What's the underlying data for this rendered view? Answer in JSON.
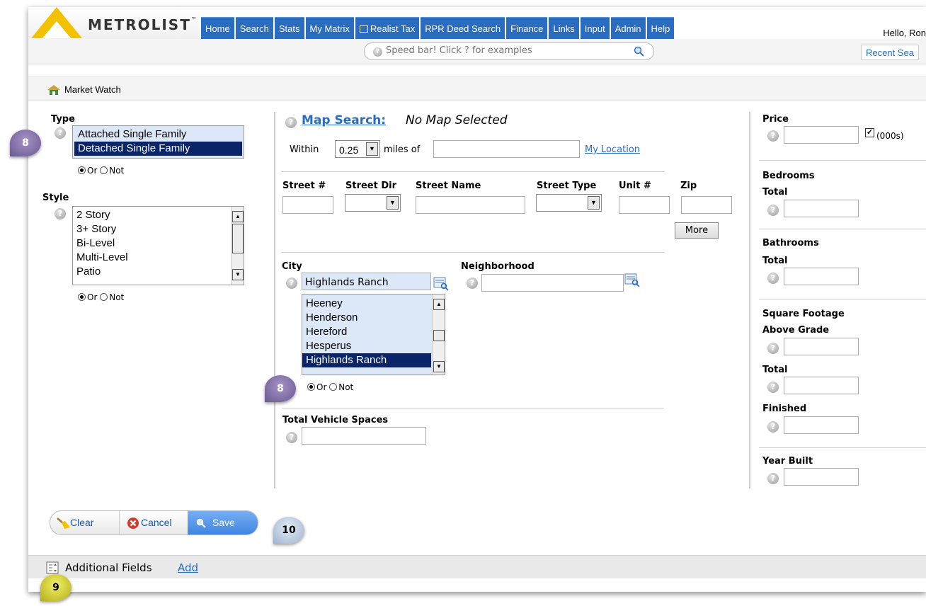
{
  "logo": {
    "text": "METROLIST",
    "tm": "™"
  },
  "nav": [
    "Home",
    "Search",
    "Stats",
    "My Matrix",
    "Realist Tax",
    "RPR Deed Search",
    "Finance",
    "Links",
    "Input",
    "Admin",
    "Help"
  ],
  "greeting": "Hello, Ron",
  "speedbar": {
    "placeholder": "Speed bar! Click ? for examples"
  },
  "recent": "Recent Sea",
  "page_title": "Market Watch",
  "type": {
    "label": "Type",
    "options": [
      "Attached Single Family",
      "Detached Single Family"
    ],
    "selected": "Detached Single Family"
  },
  "style": {
    "label": "Style",
    "options": [
      "2 Story",
      "3+ Story",
      "Bi-Level",
      "Multi-Level",
      "Patio"
    ]
  },
  "or_label": "Or",
  "not_label": "Not",
  "map": {
    "link": "Map Search:",
    "status": "No Map Selected",
    "within": "Within",
    "miles_value": "0.25",
    "miles_of": "miles of",
    "my_location": "My Location"
  },
  "address": {
    "street_num": "Street #",
    "street_dir": "Street Dir",
    "street_name": "Street Name",
    "street_type": "Street Type",
    "unit": "Unit #",
    "zip": "Zip",
    "more": "More"
  },
  "city": {
    "label": "City",
    "value": "Highlands Ranch",
    "options": [
      "Heeney",
      "Henderson",
      "Hereford",
      "Hesperus",
      "Highlands Ranch"
    ],
    "selected": "Highlands Ranch"
  },
  "neighborhood": {
    "label": "Neighborhood"
  },
  "vehicle": {
    "label": "Total Vehicle Spaces"
  },
  "price": {
    "label": "Price",
    "unit": "(000s)",
    "checked": true
  },
  "bedrooms": {
    "label": "Bedrooms",
    "sub": "Total"
  },
  "bathrooms": {
    "label": "Bathrooms",
    "sub": "Total"
  },
  "sqft": {
    "label": "Square Footage",
    "above": "Above Grade",
    "total": "Total",
    "finished": "Finished"
  },
  "year": {
    "label": "Year Built"
  },
  "buttons": {
    "clear": "Clear",
    "cancel": "Cancel",
    "save": "Save"
  },
  "additional": {
    "label": "Additional Fields",
    "add": "Add"
  },
  "badges": {
    "type": "8",
    "city": "8",
    "save": "10",
    "fields": "9"
  }
}
